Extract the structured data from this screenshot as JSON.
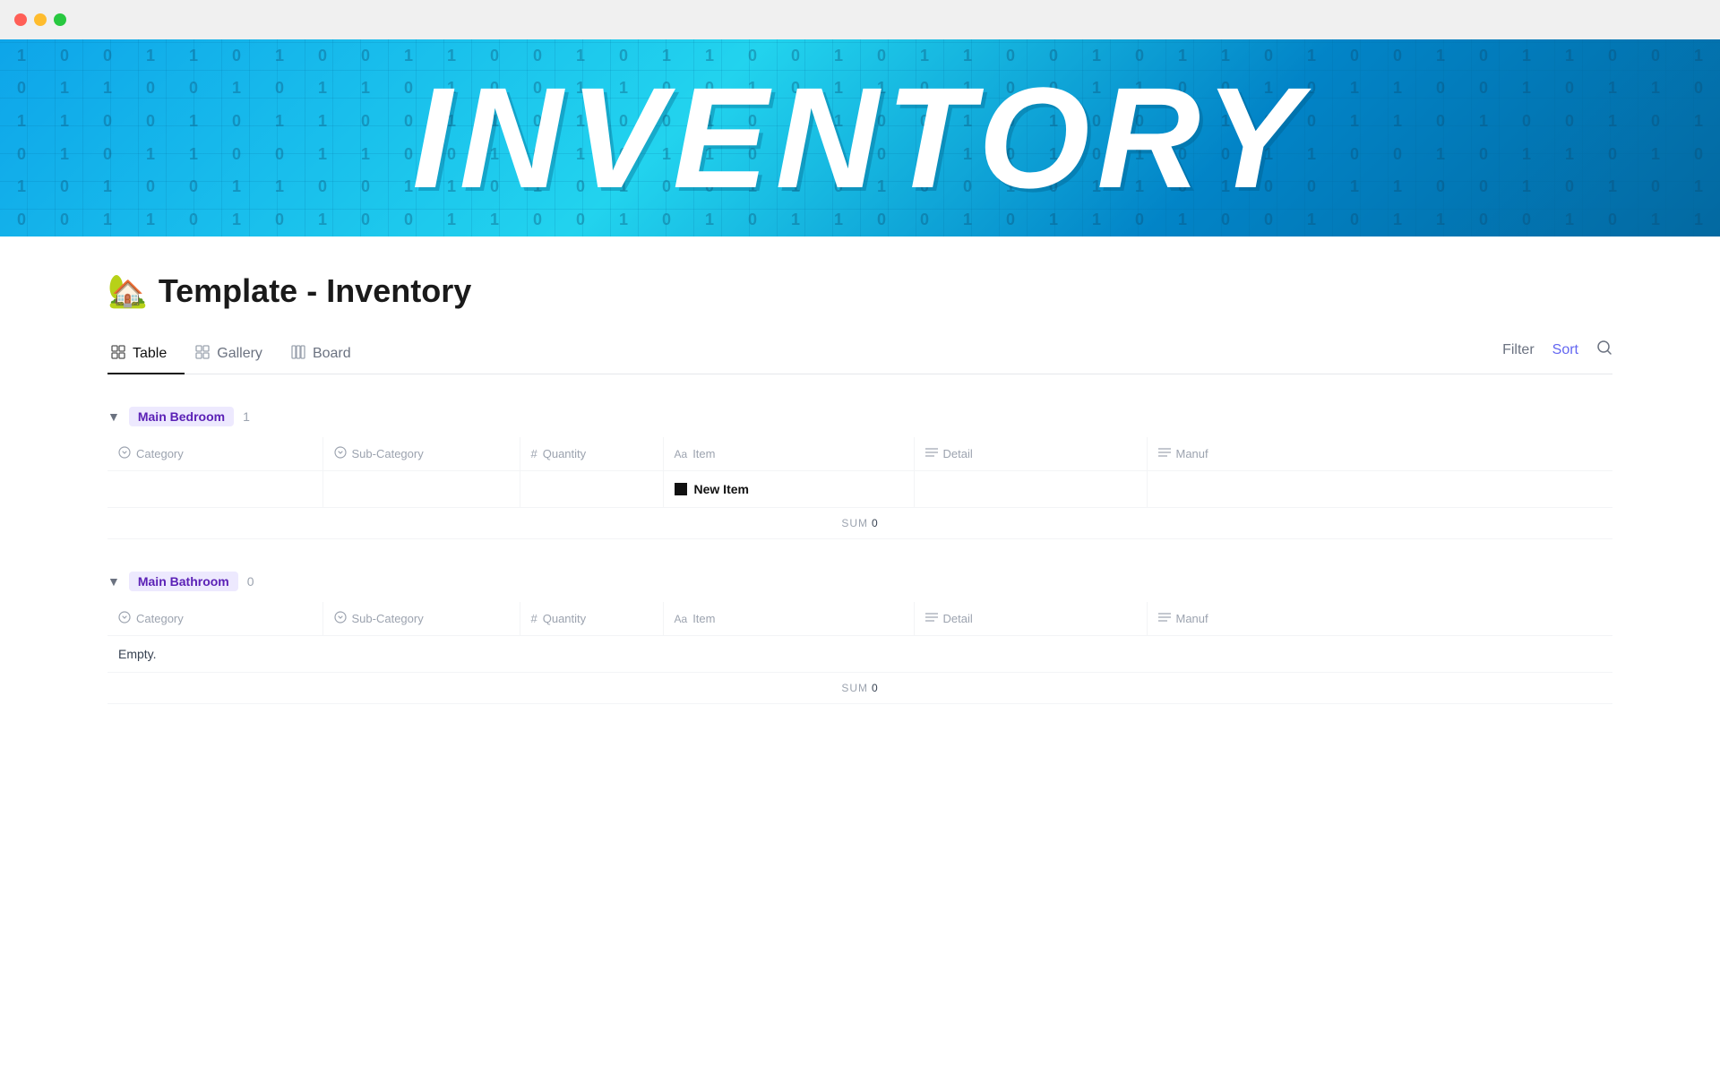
{
  "titlebar": {
    "traffic_lights": [
      "red",
      "yellow",
      "green"
    ]
  },
  "hero": {
    "title": "INVENTORY"
  },
  "page": {
    "emoji": "🏡",
    "title": "Template - Inventory"
  },
  "tabs": {
    "items": [
      {
        "label": "Table",
        "icon": "table-icon",
        "active": true
      },
      {
        "label": "Gallery",
        "icon": "gallery-icon",
        "active": false
      },
      {
        "label": "Board",
        "icon": "board-icon",
        "active": false
      }
    ],
    "actions": [
      {
        "label": "Filter",
        "active": false
      },
      {
        "label": "Sort",
        "active": true
      },
      {
        "label": "Search",
        "icon": "search-icon",
        "active": false
      }
    ]
  },
  "groups": [
    {
      "id": "main-bedroom",
      "label": "Main Bedroom",
      "count": "1",
      "columns": [
        "Category",
        "Sub-Category",
        "Quantity",
        "Item",
        "Detail",
        "Manuf"
      ],
      "column_types": [
        "select",
        "select",
        "number",
        "text",
        "text",
        "text"
      ],
      "rows": [
        {
          "category": "",
          "sub_category": "",
          "quantity": "",
          "item": "New Item",
          "detail": "",
          "manuf": ""
        }
      ],
      "sum_label": "SUM",
      "sum_value": "0",
      "empty": false
    },
    {
      "id": "main-bathroom",
      "label": "Main Bathroom",
      "count": "0",
      "columns": [
        "Category",
        "Sub-Category",
        "Quantity",
        "Item",
        "Detail",
        "Manuf"
      ],
      "column_types": [
        "select",
        "select",
        "number",
        "text",
        "text",
        "text"
      ],
      "rows": [],
      "sum_label": "SUM",
      "sum_value": "0",
      "empty": true,
      "empty_text": "Empty."
    }
  ]
}
